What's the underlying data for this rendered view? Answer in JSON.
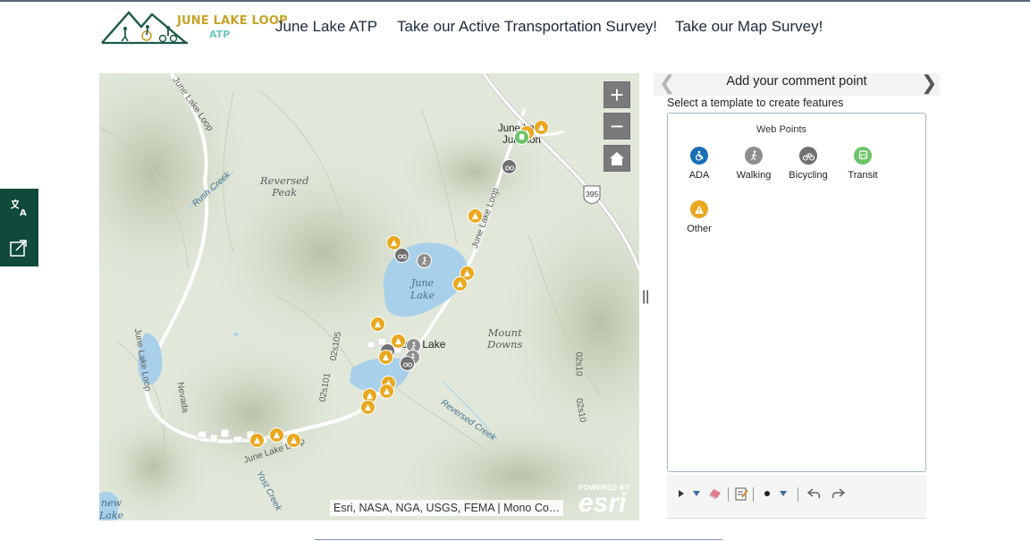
{
  "header": {
    "logo": {
      "line1": "JUNE LAKE LOOP",
      "line2": "ATP"
    },
    "nav": [
      {
        "label": "June Lake ATP"
      },
      {
        "label": "Take our Active Transportation Survey!"
      },
      {
        "label": "Take our Map Survey!"
      }
    ]
  },
  "side_tools": [
    {
      "icon": "translate-icon"
    },
    {
      "icon": "share-icon"
    }
  ],
  "map": {
    "zoom_in": "+",
    "zoom_out": "−",
    "home_icon": "home-icon",
    "attribution": "Esri, NASA, NGA, USGS, FEMA | Mono Co…",
    "powered_by": "POWERED BY",
    "esri": "esri",
    "labels": {
      "reversed_peak": "Reversed\nPeak",
      "mount_downs": "Mount\nDowns",
      "june_lake_water": "June\nLake",
      "june_lake_town": "June Lake",
      "junction": "June Lake\nJunction",
      "rush_creek": "Rush Creek",
      "reversed_creek": "Reversed Creek",
      "yost_creek": "Yost Creek",
      "new_lake": "new\nLake",
      "june_lake_loop_1": "June Lake Loop",
      "june_lake_loop_2": "June Lake Loop",
      "june_lake_loop_3": "June Lake Loop",
      "june_lake_loop_4": "June Lake Loop",
      "nevada": "Nevada",
      "rd_02s101": "02s101",
      "rd_02s10": "02s10",
      "rd_02s10b": "02s10",
      "rd_02s105": "02s105",
      "hwy_395": "395"
    }
  },
  "panel": {
    "title": "Add your comment point",
    "helper": "Select a template to create features",
    "picker_title": "Web Points",
    "templates": [
      {
        "label": "ADA",
        "color": "#1a6fb5"
      },
      {
        "label": "Walking",
        "color": "#8e8e8e"
      },
      {
        "label": "Bicycling",
        "color": "#707070"
      },
      {
        "label": "Transit",
        "color": "#6cc469"
      },
      {
        "label": "Other",
        "color": "#e9a81f"
      }
    ]
  },
  "colors": {
    "sidebar": "#0f4a3c",
    "accent_gold": "#c9a227",
    "accent_teal": "#6ec6c2",
    "water": "#a9d0ea"
  }
}
